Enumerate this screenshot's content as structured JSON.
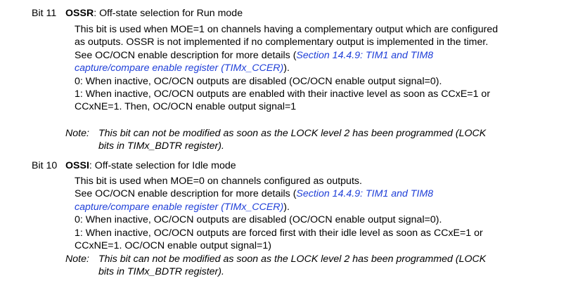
{
  "sections": [
    {
      "bit_label": "Bit 11",
      "field": "OSSR",
      "title_rest": ": Off-state selection for Run mode",
      "para1": "This bit is used when MOE=1 on channels having a complementary output which are configured as outputs. OSSR is not implemented if no complementary output is implemented in the timer.",
      "see_pre": "See OC/OCN enable description for more details (",
      "see_link": "Section 14.4.9: TIM1 and TIM8 capture/compare enable register (TIMx_CCER)",
      "see_post": ").",
      "opt0": "0: When inactive, OC/OCN outputs are disabled (OC/OCN enable output signal=0).",
      "opt1": "1: When inactive, OC/OCN outputs are enabled with their inactive level as soon as CCxE=1 or CCxNE=1. Then, OC/OCN enable output signal=1",
      "note_label": "Note:",
      "note_text": "This bit can not be modified as soon as the LOCK level 2 has been programmed (LOCK bits in TIMx_BDTR register)."
    },
    {
      "bit_label": "Bit 10",
      "field": "OSSI",
      "title_rest": ": Off-state selection for Idle mode",
      "para1": "This bit is used when MOE=0 on channels configured as outputs.",
      "see_pre": "See OC/OCN enable description for more details (",
      "see_link": "Section 14.4.9: TIM1 and TIM8 capture/compare enable register (TIMx_CCER)",
      "see_post": ").",
      "opt0": "0: When inactive, OC/OCN outputs are disabled (OC/OCN enable output signal=0).",
      "opt1": "1: When inactive, OC/OCN outputs are forced first with their idle level as soon as CCxE=1 or CCxNE=1. OC/OCN enable output signal=1)",
      "note_label": "Note:",
      "note_text": "This bit can not be modified as soon as the LOCK level 2 has been programmed (LOCK bits in TIMx_BDTR register)."
    }
  ],
  "colors": {
    "text": "#000000",
    "link": "#1f3fd8",
    "background": "#ffffff"
  }
}
